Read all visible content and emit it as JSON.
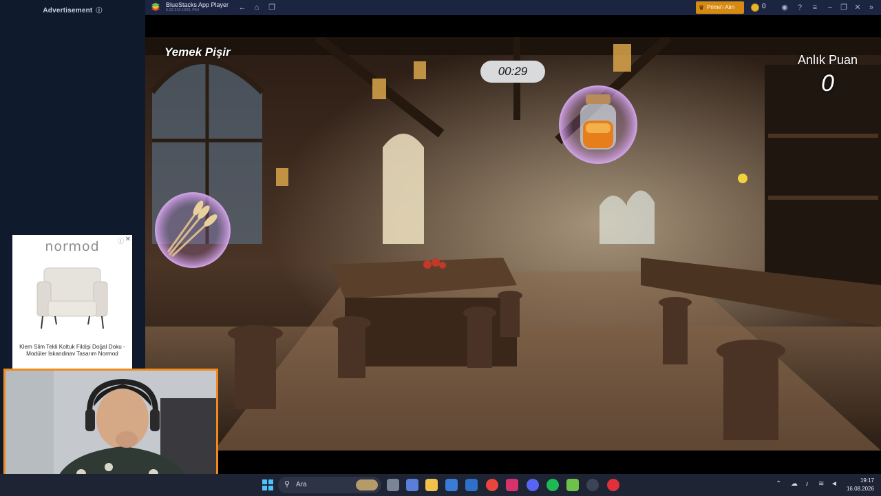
{
  "advertisement": {
    "header": "Advertisement",
    "brand": "normod",
    "caption": "Klem Slim Tekli Koltuk Fildişi Doğal Doku - Modüler İskandinav Tasarım Normod",
    "info_icon": "info-icon",
    "close_icon": "close-icon"
  },
  "window": {
    "title": "BlueStacks App Player",
    "version": "5.22.210.1033, P64",
    "prime_label": "Prime'ı Alın",
    "coin_count": "0",
    "icons": [
      "back-arrow-icon",
      "home-icon",
      "recent-apps-icon",
      "account-icon",
      "help-icon",
      "menu-icon",
      "minimize-icon",
      "restore-icon",
      "close-icon"
    ]
  },
  "game": {
    "title": "Yemek Pişir",
    "timer": "00:29",
    "score_label": "Anlık Puan",
    "score": "0",
    "items": [
      "wheat-bubble",
      "honey-jar-bubble"
    ]
  },
  "taskbar": {
    "search_placeholder": "Ara",
    "time": "19:17",
    "date": "16.08.2026",
    "accent": "#f08a1c"
  }
}
